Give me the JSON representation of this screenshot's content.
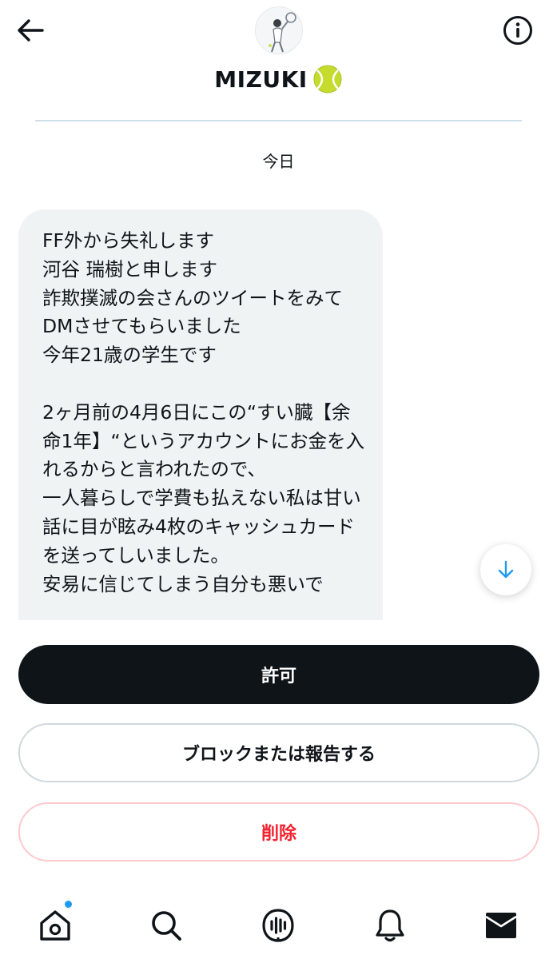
{
  "header": {
    "title": "MIZUKI",
    "title_emoji": "🎾",
    "avatar_alt": "profile picture"
  },
  "conversation": {
    "date_label": "今日",
    "message_text": "FF外から失礼します\n河谷 瑞樹と申します\n詐欺撲滅の会さんのツイートをみてDMさせてもらいました\n今年21歳の学生です\n\n2ヶ月前の4月6日にこの“すい臓【余命1年】“というアカウントにお金を入れるからと言われたので、\n一人暮らしで学費も払えない私は甘い話に目が眩み4枚のキャッシュカードを送ってしいました。\n安易に信じてしまう自分も悪いで"
  },
  "actions": {
    "allow_label": "許可",
    "block_label": "ブロックまたは報告する",
    "delete_label": "削除"
  },
  "nav": {
    "items": [
      {
        "icon": "home-icon",
        "has_notification_dot": true
      },
      {
        "icon": "search-icon"
      },
      {
        "icon": "spaces-icon"
      },
      {
        "icon": "notifications-icon"
      },
      {
        "icon": "messages-icon"
      }
    ]
  },
  "colors": {
    "primary_text": "#0f1419",
    "bubble_bg": "#eff3f4",
    "accent_blue": "#1d9bf0",
    "danger_red": "#f4212e"
  }
}
